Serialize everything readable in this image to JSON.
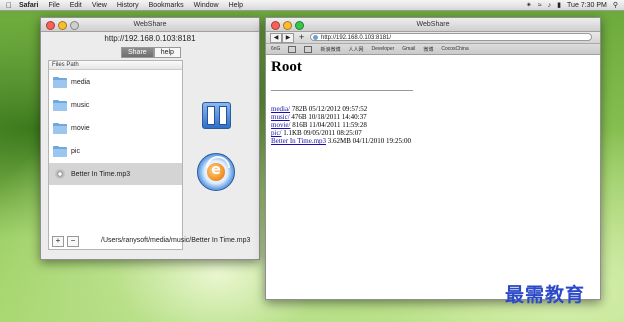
{
  "menubar": {
    "apple": "",
    "items": [
      "Safari",
      "File",
      "Edit",
      "View",
      "History",
      "Bookmarks",
      "Window",
      "Help"
    ],
    "clock": "Tue 7:30 PM"
  },
  "webshare": {
    "title": "WebShare",
    "server_url": "http://192.168.0.103:8181",
    "tabs": [
      "Share",
      "help"
    ],
    "column_header": "Files Path",
    "files": [
      {
        "name": "media",
        "type": "folder"
      },
      {
        "name": "music",
        "type": "folder"
      },
      {
        "name": "movie",
        "type": "folder"
      },
      {
        "name": "pic",
        "type": "folder"
      },
      {
        "name": "Better In Time.mp3",
        "type": "file"
      }
    ],
    "add_label": "+",
    "remove_label": "−",
    "path": "/Users/ranysoft/media/music/Better In Time.mp3"
  },
  "safari": {
    "title": "WebShare",
    "address": "http://192.168.0.103:8181/",
    "bookmarks": [
      "6nG",
      "新浪微博",
      "人人网",
      "Developer",
      "Gmail",
      "微博",
      "CocosChina"
    ],
    "heading": "Root",
    "entries": [
      {
        "name": "media/",
        "info": "782B 05/12/2012 09:57:52"
      },
      {
        "name": "music/",
        "info": "476B 10/18/2011 14:40:37"
      },
      {
        "name": "movie/",
        "info": "816B 11/04/2011 11:59:28"
      },
      {
        "name": "pic/",
        "info": "1.1KB 09/05/2011 08:25:07"
      },
      {
        "name": "Better In Time.mp3",
        "info": "3.62MB 04/11/2010 19:25:00"
      }
    ]
  },
  "watermark": "最需教育"
}
